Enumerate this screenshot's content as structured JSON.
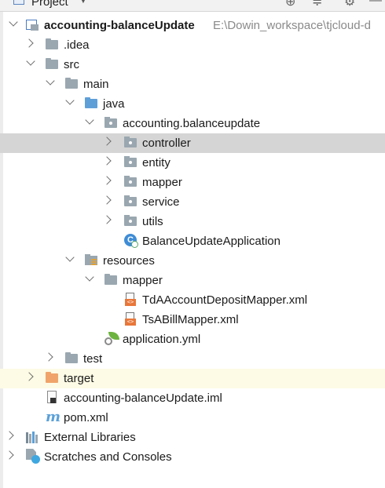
{
  "header": {
    "title": "Project",
    "icons": [
      "target-icon",
      "collapse-icon",
      "gear-icon",
      "minimize-icon"
    ]
  },
  "tree": {
    "root": {
      "label": "accounting-balanceUpdate",
      "path": "E:\\Dowin_workspace\\tjcloud-d"
    },
    "idea": "idea",
    "idea_label": ".idea",
    "src": "src",
    "main": "main",
    "java": "java",
    "package": "accounting.balanceupdate",
    "controller": "controller",
    "entity": "entity",
    "mapper_pkg": "mapper",
    "service": "service",
    "utils": "utils",
    "app_class": "BalanceUpdateApplication",
    "resources": "resources",
    "mapper_res": "mapper",
    "xml1": "TdAAccountDepositMapper.xml",
    "xml2": "TsABillMapper.xml",
    "yml": "application.yml",
    "test": "test",
    "target": "target",
    "iml": "accounting-balanceUpdate.iml",
    "pom": "pom.xml",
    "ext_libs": "External Libraries",
    "scratches": "Scratches and Consoles",
    "class_letter": "C",
    "xml_tag": "<>",
    "maven_letter": "m"
  },
  "colors": {
    "selection": "#d5d5d5",
    "excluded_highlight": "#fdfbe5",
    "source_folder": "#5f9fd8",
    "excluded_folder": "#f0a46b",
    "folder": "#9aa7b0"
  }
}
